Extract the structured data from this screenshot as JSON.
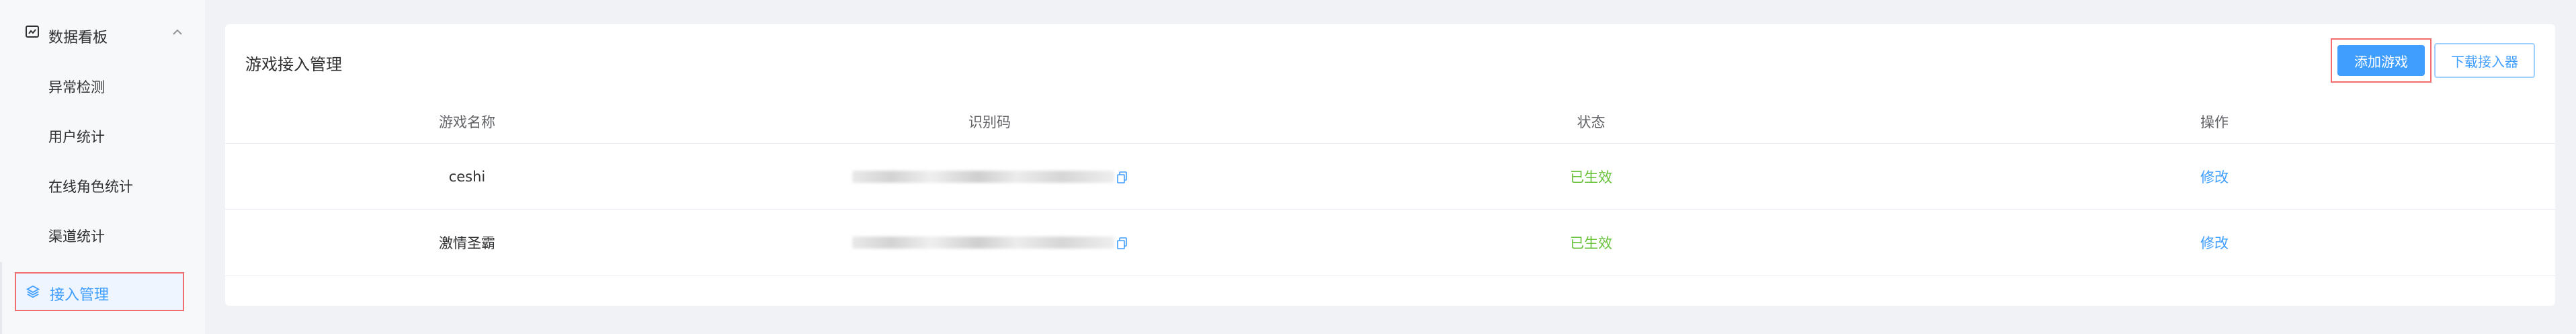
{
  "sidebar": {
    "group_label": "数据看板",
    "items": [
      {
        "label": "异常检测"
      },
      {
        "label": "用户统计"
      },
      {
        "label": "在线角色统计"
      },
      {
        "label": "渠道统计"
      }
    ],
    "active_label": "接入管理"
  },
  "main": {
    "title": "游戏接入管理",
    "add_button": "添加游戏",
    "download_button": "下载接入器",
    "columns": [
      "游戏名称",
      "识别码",
      "状态",
      "操作"
    ],
    "rows": [
      {
        "name": "ceshi",
        "status": "已生效",
        "action": "修改"
      },
      {
        "name": "激情圣霸",
        "status": "已生效",
        "action": "修改"
      }
    ]
  },
  "colors": {
    "accent": "#409eff",
    "success": "#67c23a",
    "highlight_border": "#f26d6d"
  },
  "icons": {
    "group": "chart-icon",
    "collapse": "chevron-up-icon",
    "active": "layers-icon",
    "copy": "copy-icon"
  }
}
